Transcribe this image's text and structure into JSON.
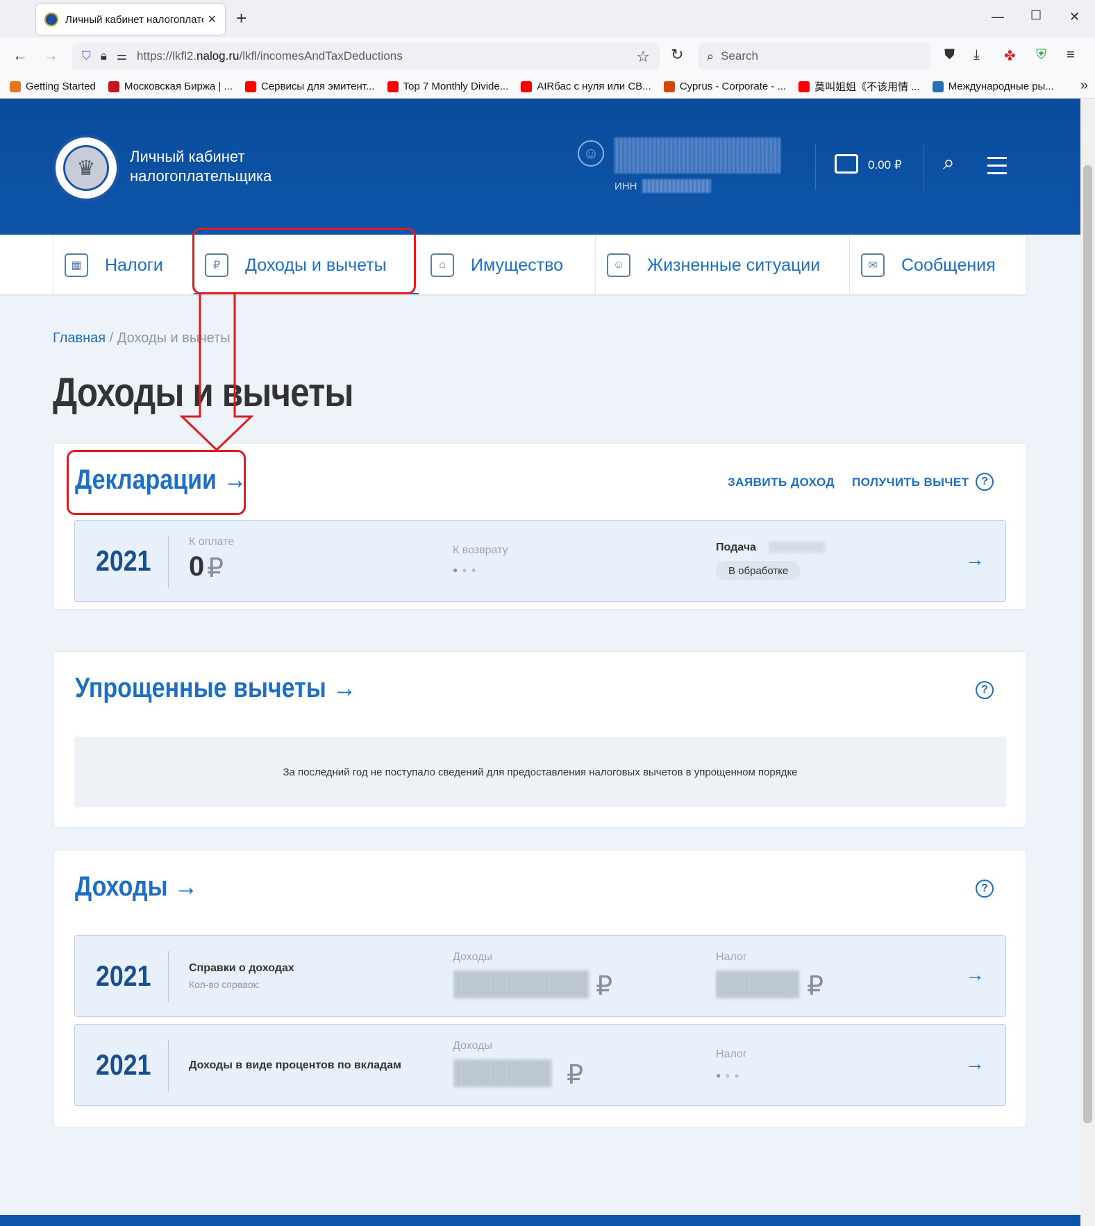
{
  "browser": {
    "tab_title": "Личный кабинет налогоплате…",
    "url_prefix": "https://lkfl2.",
    "url_host": "nalog.ru",
    "url_path": "/lkfl/incomesAndTaxDeductions",
    "search_placeholder": "Search",
    "bookmarks": [
      {
        "label": "Getting Started",
        "color": "#e8741c"
      },
      {
        "label": "Московская Биржа | ...",
        "color": "#c4161c"
      },
      {
        "label": "Сервисы для эмитент...",
        "color": "#ff0000"
      },
      {
        "label": "Top 7 Monthly Divide...",
        "color": "#ff0000"
      },
      {
        "label": "AIRбас с нуля или СВ...",
        "color": "#ff0000"
      },
      {
        "label": "Cyprus - Corporate - ...",
        "color": "#d04a02"
      },
      {
        "label": "莫叫姐姐《不该用情 ...",
        "color": "#ff0000"
      },
      {
        "label": "Международные ры...",
        "color": "#2a6fb5"
      }
    ]
  },
  "header": {
    "brand_line1": "Личный кабинет",
    "brand_line2": "налогоплательщика",
    "inn_label": "ИНН",
    "balance": "0.00 ₽"
  },
  "nav": [
    {
      "label": "Налоги",
      "icon": "calculator-icon"
    },
    {
      "label": "Доходы и вычеты",
      "icon": "ruble-cards-icon"
    },
    {
      "label": "Имущество",
      "icon": "house-icon"
    },
    {
      "label": "Жизненные ситуации",
      "icon": "people-icon"
    },
    {
      "label": "Сообщения",
      "icon": "envelope-icon"
    }
  ],
  "breadcrumb": {
    "home": "Главная",
    "sep": " / ",
    "current": "Доходы и вычеты"
  },
  "page_title": "Доходы и вычеты",
  "declarations": {
    "title": "Декларации",
    "link_income": "ЗАЯВИТЬ ДОХОД",
    "link_deduction": "ПОЛУЧИТЬ ВЫЧЕТ",
    "row": {
      "year": "2021",
      "to_pay_label": "К оплате",
      "to_pay_value": "0",
      "currency": "₽",
      "refund_label": "К возврату",
      "filing_label": "Подача",
      "status": "В обработке"
    }
  },
  "simplified": {
    "title": "Упрощенные вычеты",
    "message": "За последний год не поступало сведений для предоставления налоговых вычетов в упрощенном порядке"
  },
  "incomes": {
    "title": "Доходы",
    "rows": [
      {
        "year": "2021",
        "title": "Справки о доходах",
        "subtitle": "Кол-во справок:",
        "income_label": "Доходы",
        "tax_label": "Налог",
        "currency": "₽"
      },
      {
        "year": "2021",
        "title": "Доходы в виде процентов по вкладам",
        "income_label": "Доходы",
        "tax_label": "Налог",
        "currency": "₽"
      }
    ]
  }
}
